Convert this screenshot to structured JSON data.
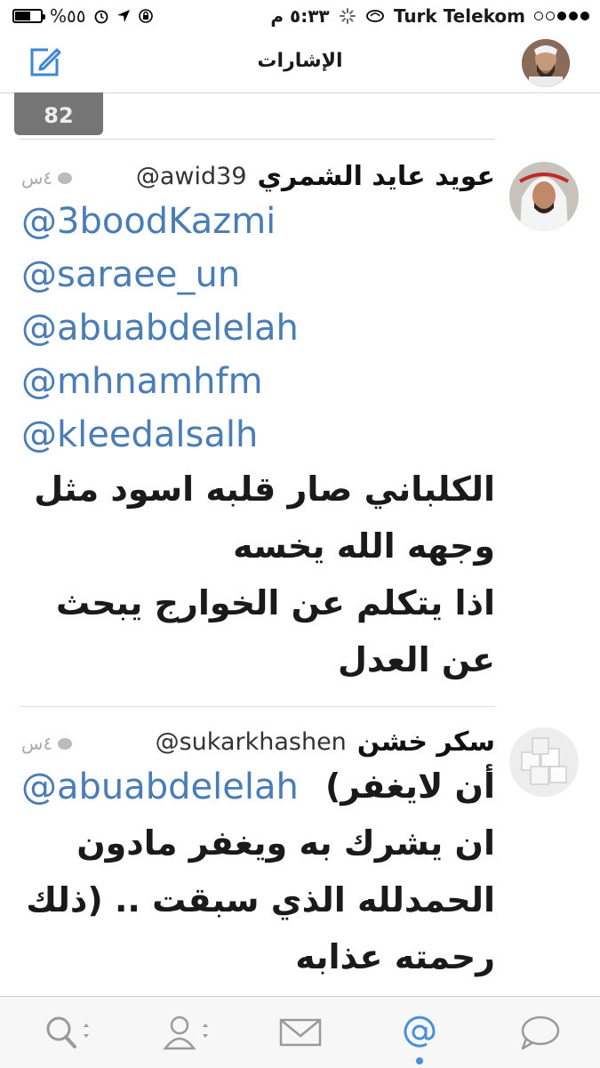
{
  "status_bar": {
    "battery": "%٥٥",
    "time": "٥:٣٣ م",
    "carrier": "Turk Telekom"
  },
  "nav": {
    "title": "الإشارات"
  },
  "partial_count": "82",
  "tweets": [
    {
      "name": "عويد عايد الشمري",
      "handle": "@awid39",
      "time": "٤س",
      "mentions": [
        "@3boodKazmi",
        "@saraee_un",
        "@abuabdelelah",
        "@mhnamhfm",
        "@kleedalsalh"
      ],
      "text_lines": [
        "الكلباني صار قلبه اسود مثل",
        "وجهه الله يخسه",
        "اذا يتكلم عن الخوارج يبحث",
        "عن العدل"
      ]
    },
    {
      "name": "سكر خشن",
      "handle": "@sukarkhashen",
      "time": "٤س",
      "first_line_mention": "@abuabdelelah",
      "first_line_text": "أن لايغفر)",
      "text_lines": [
        "ان يشرك به ويغفر مادون",
        "الحمدلله الذي سبقت .. (ذلك",
        "رحمته عذابه"
      ]
    }
  ],
  "tab_bar": {
    "tabs": [
      "search-icon",
      "profile-icon",
      "messages-icon",
      "mentions-icon",
      "chat-icon"
    ],
    "active": "mentions-icon",
    "accent": "#4a90d9"
  }
}
